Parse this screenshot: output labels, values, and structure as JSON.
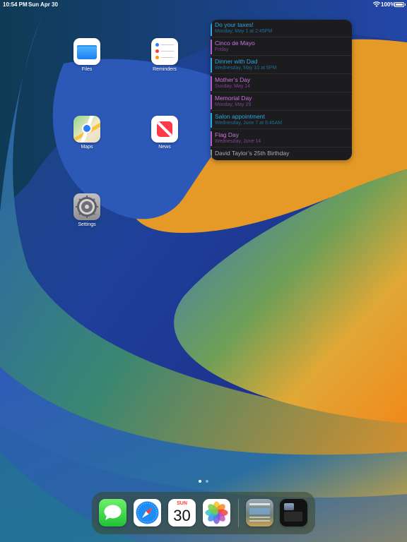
{
  "status_bar": {
    "time": "10:54 PM",
    "date": "Sun Apr 30",
    "battery_percent": "100%",
    "battery_level": 1.0
  },
  "home_apps": [
    {
      "label": "Files",
      "icon": "folder-icon"
    },
    {
      "label": "Reminders",
      "icon": "reminders-icon"
    },
    {
      "label": "Maps",
      "icon": "maps-icon"
    },
    {
      "label": "News",
      "icon": "news-icon"
    },
    {
      "label": "Settings",
      "icon": "gear-icon"
    }
  ],
  "calendar_widget": {
    "events": [
      {
        "title": "Do your taxes!",
        "subtitle": "Monday, May 1 at 2:45PM",
        "color": "#2ea7e0"
      },
      {
        "title": "Cinco de Mayo",
        "subtitle": "Friday",
        "color": "#b45fc8"
      },
      {
        "title": "Dinner with Dad",
        "subtitle": "Wednesday, May 10 at 5PM",
        "color": "#2ea7e0"
      },
      {
        "title": "Mother’s Day",
        "subtitle": "Sunday, May 14",
        "color": "#b45fc8"
      },
      {
        "title": "Memorial Day",
        "subtitle": "Monday, May 29",
        "color": "#b45fc8"
      },
      {
        "title": "Salon appointment",
        "subtitle": "Wednesday, June 7 at 8:45AM",
        "color": "#2ea7e0"
      },
      {
        "title": "Flag Day",
        "subtitle": "Wednesday, June 14",
        "color": "#b45fc8"
      },
      {
        "title": "David Taylor’s 25th Birthday",
        "subtitle": "",
        "color": "#8e8e93"
      }
    ]
  },
  "page_indicator": {
    "current": 1,
    "total": 2
  },
  "dock": {
    "apps": [
      {
        "name": "messages-icon"
      },
      {
        "name": "safari-icon"
      },
      {
        "name": "calendar-icon",
        "day_label": "SUN",
        "day_number": "30"
      },
      {
        "name": "photos-icon"
      }
    ],
    "recents": [
      {
        "name": "recent-app-1-icon"
      },
      {
        "name": "recent-app-2-icon"
      }
    ]
  },
  "colors": {
    "event_blue": "#2ea7e0",
    "event_purple": "#b45fc8",
    "widget_bg": "#1c1c1e"
  }
}
